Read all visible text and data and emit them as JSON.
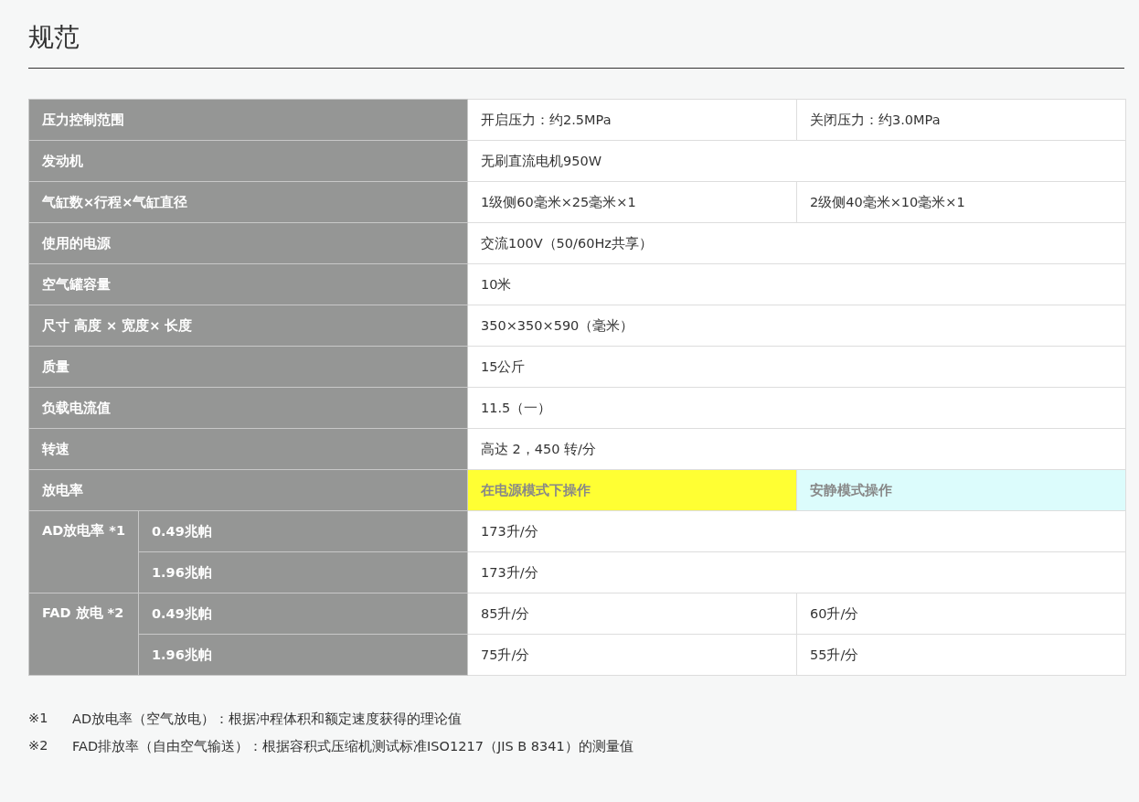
{
  "title": "规范",
  "rows": [
    {
      "kind": "spec",
      "label": "压力控制范围",
      "values": [
        {
          "text": "开启压力：约2.5MPa"
        },
        {
          "text": "关闭压力：约3.0MPa"
        }
      ]
    },
    {
      "kind": "spec",
      "label": "发动机",
      "values": [
        {
          "text": "无刷直流电机950W"
        }
      ]
    },
    {
      "kind": "spec",
      "label": "气缸数×行程×气缸直径",
      "values": [
        {
          "text": "1级侧60毫米×25毫米×1"
        },
        {
          "text": "2级侧40毫米×10毫米×1"
        }
      ]
    },
    {
      "kind": "spec",
      "label": "使用的电源",
      "values": [
        {
          "text": "交流100V（50/60Hz共享）"
        }
      ]
    },
    {
      "kind": "spec",
      "label": "空气罐容量",
      "values": [
        {
          "text": "10米"
        }
      ]
    },
    {
      "kind": "spec",
      "label": "尺寸 高度 × 宽度× 长度",
      "values": [
        {
          "text": "350×350×590（毫米）"
        }
      ]
    },
    {
      "kind": "spec",
      "label": "质量",
      "values": [
        {
          "text": "15公斤"
        }
      ]
    },
    {
      "kind": "spec",
      "label": "负载电流值",
      "values": [
        {
          "text": "11.5（一）"
        }
      ]
    },
    {
      "kind": "spec",
      "label": "转速",
      "values": [
        {
          "text": "高达 2，450 转/分"
        }
      ]
    },
    {
      "kind": "header",
      "label": "放电率",
      "values": [
        {
          "text": "在电源模式下操作",
          "color": "#ffff33"
        },
        {
          "text": "安静模式操作",
          "color": "#dcfcfc"
        }
      ]
    }
  ],
  "groups": [
    {
      "label": "AD放电率 *1",
      "rows": [
        {
          "label": "0.49兆帕",
          "values": [
            {
              "text": "173升/分"
            }
          ]
        },
        {
          "label": "1.96兆帕",
          "values": [
            {
              "text": "173升/分"
            }
          ]
        }
      ]
    },
    {
      "label": "FAD 放电 *2",
      "rows": [
        {
          "label": "0.49兆帕",
          "values": [
            {
              "text": "85升/分"
            },
            {
              "text": "60升/分"
            }
          ]
        },
        {
          "label": "1.96兆帕",
          "values": [
            {
              "text": "75升/分"
            },
            {
              "text": "55升/分"
            }
          ]
        }
      ]
    }
  ],
  "footnotes": [
    {
      "mark": "※1",
      "text": "AD放电率（空气放电）：根据冲程体积和额定速度获得的理论值"
    },
    {
      "mark": "※2",
      "text": "FAD排放率（自由空气输送）：根据容积式压缩机测试标准ISO1217（JIS B 8341）的测量值"
    }
  ]
}
